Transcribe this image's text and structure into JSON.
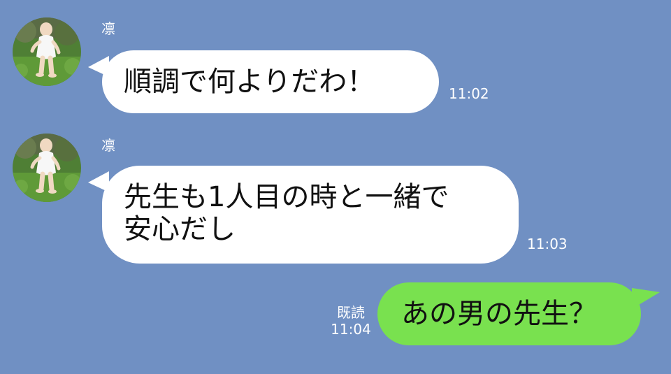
{
  "colors": {
    "chat_background": "#7090c3",
    "incoming_bubble": "#ffffff",
    "outgoing_bubble": "#79e14f",
    "meta_text": "#ffffff"
  },
  "messages": [
    {
      "sender": "凛",
      "direction": "incoming",
      "text_lines": [
        "順調で何よりだわ！"
      ],
      "time": "11:02",
      "avatar": "baby-photo-avatar"
    },
    {
      "sender": "凛",
      "direction": "incoming",
      "text_lines": [
        "先生も1人目の時と一緒で",
        "安心だし"
      ],
      "time": "11:03",
      "avatar": "baby-photo-avatar"
    },
    {
      "direction": "outgoing",
      "text_lines": [
        "あの男の先生？"
      ],
      "read_label": "既読",
      "time": "11:04"
    }
  ]
}
